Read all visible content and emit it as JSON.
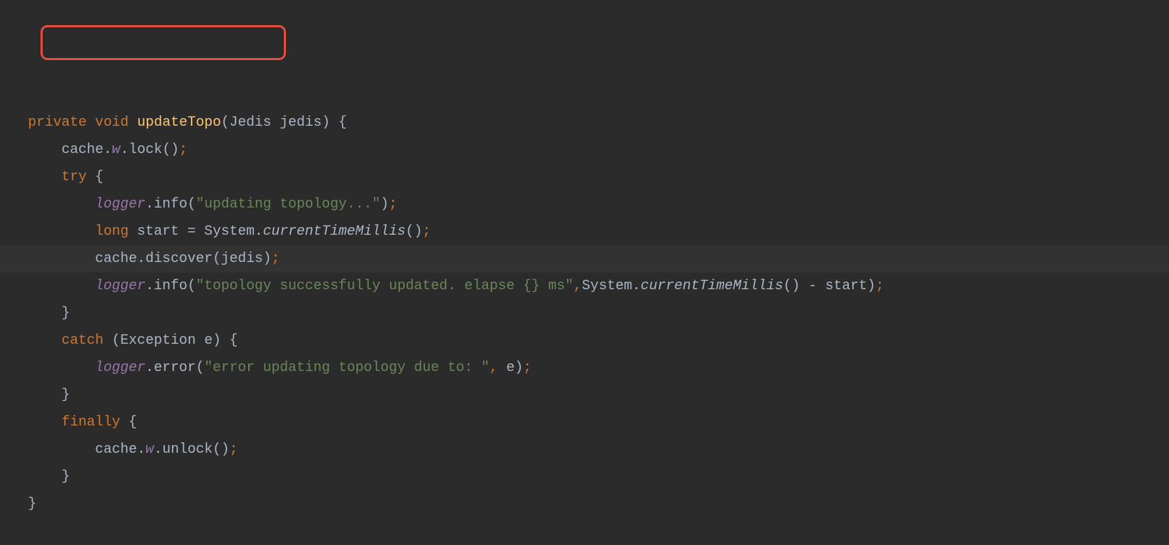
{
  "code": {
    "line1": {
      "kw_private": "private",
      "kw_void": "void",
      "method": "updateTopo",
      "paren_open": "(",
      "param_type": "Jedis",
      "param_name": "jedis",
      "paren_close": ")",
      "brace": " {"
    },
    "line2": {
      "cache": "cache",
      "dot1": ".",
      "w": "w",
      "dot2": ".",
      "lock": "lock",
      "parens": "()",
      "semi": ";"
    },
    "line3": {
      "kw_try": "try",
      "brace": " {"
    },
    "line4": {
      "logger": "logger",
      "dot": ".",
      "info": "info",
      "paren_open": "(",
      "str": "\"updating topology...\"",
      "paren_close": ")",
      "semi": ";"
    },
    "line5": {
      "kw_long": "long",
      "start": "start ",
      "eq": "= ",
      "system": "System.",
      "ctm": "currentTimeMillis",
      "parens": "()",
      "semi": ";"
    },
    "line6": {
      "cache": "cache",
      "dot": ".",
      "discover": "discover",
      "paren_open": "(",
      "jedis": "jedis",
      "paren_close": ")",
      "semi": ";"
    },
    "line7": {
      "logger": "logger",
      "dot": ".",
      "info": "info",
      "paren_open": "(",
      "str": "\"topology successfully updated. elapse {} ms\"",
      "comma": ",",
      "system": "System.",
      "ctm": "currentTimeMillis",
      "parens": "()",
      "minus": " - ",
      "start": "start",
      "paren_close": ")",
      "semi": ";"
    },
    "line8": {
      "brace": "}"
    },
    "line9": {
      "kw_catch": "catch",
      "paren_open": " (",
      "exc_type": "Exception",
      "exc_name": " e",
      "paren_close": ")",
      "brace": " {"
    },
    "line10": {
      "logger": "logger",
      "dot": ".",
      "error": "error",
      "paren_open": "(",
      "str": "\"error updating topology due to: \"",
      "comma": ",",
      "e": " e",
      "paren_close": ")",
      "semi": ";"
    },
    "line11": {
      "brace": "}"
    },
    "line12": {
      "kw_finally": "finally",
      "brace": " {"
    },
    "line13": {
      "cache": "cache",
      "dot1": ".",
      "w": "w",
      "dot2": ".",
      "unlock": "unlock",
      "parens": "()",
      "semi": ";"
    },
    "line14": {
      "brace": "}"
    },
    "line15": {
      "brace": "}"
    }
  }
}
